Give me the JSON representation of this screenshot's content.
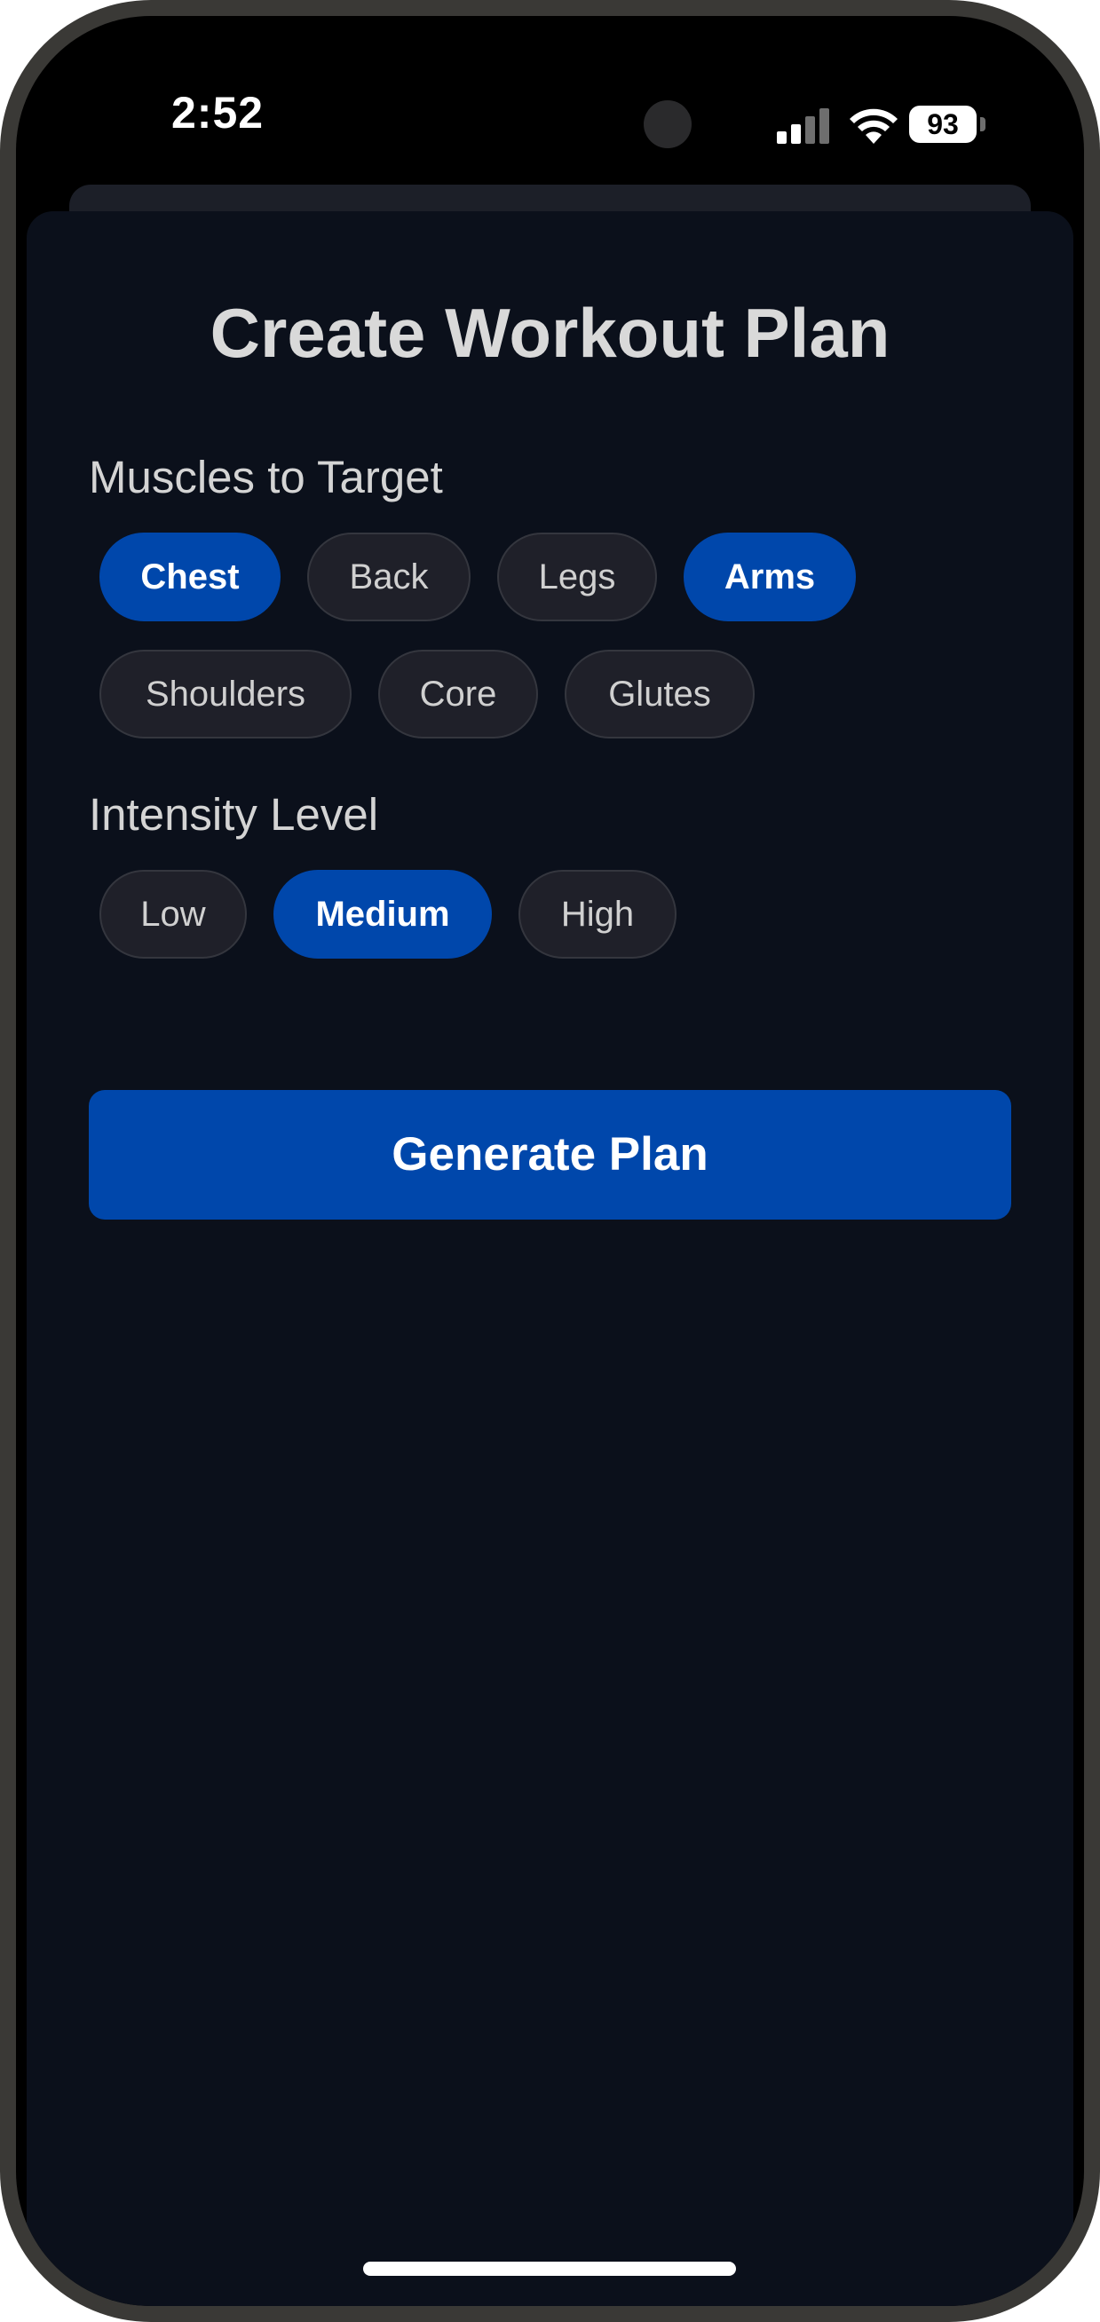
{
  "status_bar": {
    "time": "2:52",
    "battery_level": "93",
    "icons": [
      "signal-icon",
      "wifi-icon",
      "battery-icon"
    ]
  },
  "screen": {
    "title": "Create Workout Plan",
    "muscles": {
      "label": "Muscles to Target",
      "options": [
        {
          "label": "Chest",
          "selected": true
        },
        {
          "label": "Back",
          "selected": false
        },
        {
          "label": "Legs",
          "selected": false
        },
        {
          "label": "Arms",
          "selected": true
        },
        {
          "label": "Shoulders",
          "selected": false
        },
        {
          "label": "Core",
          "selected": false
        },
        {
          "label": "Glutes",
          "selected": false
        }
      ]
    },
    "intensity": {
      "label": "Intensity Level",
      "options": [
        {
          "label": "Low",
          "selected": false
        },
        {
          "label": "Medium",
          "selected": true
        },
        {
          "label": "High",
          "selected": false
        }
      ]
    },
    "generate_label": "Generate Plan"
  },
  "colors": {
    "accent": "#0047ab",
    "background": "#0b101b",
    "chip_background": "#1f2029",
    "text": "#d9d9d9"
  }
}
